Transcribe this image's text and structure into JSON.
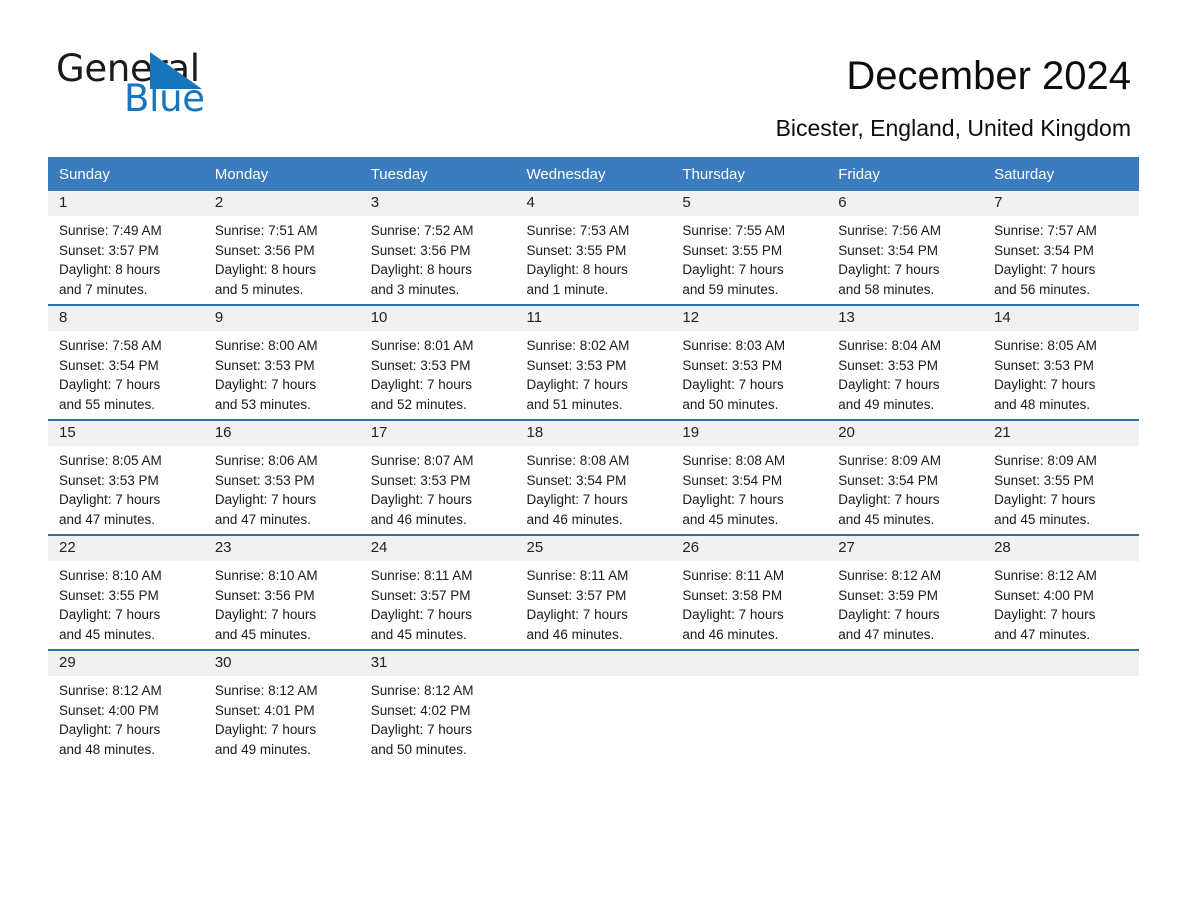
{
  "brand": {
    "name_part1": "General",
    "name_part2": "Blue",
    "accent_color": "#1675bc"
  },
  "header": {
    "title": "December 2024",
    "location": "Bicester, England, United Kingdom"
  },
  "calendar": {
    "header_bg": "#3a7cbe",
    "daynum_bg": "#f1f1f1",
    "weekdays": [
      "Sunday",
      "Monday",
      "Tuesday",
      "Wednesday",
      "Thursday",
      "Friday",
      "Saturday"
    ],
    "weeks": [
      [
        {
          "day": "1",
          "sunrise": "Sunrise: 7:49 AM",
          "sunset": "Sunset: 3:57 PM",
          "daylight1": "Daylight: 8 hours",
          "daylight2": "and 7 minutes."
        },
        {
          "day": "2",
          "sunrise": "Sunrise: 7:51 AM",
          "sunset": "Sunset: 3:56 PM",
          "daylight1": "Daylight: 8 hours",
          "daylight2": "and 5 minutes."
        },
        {
          "day": "3",
          "sunrise": "Sunrise: 7:52 AM",
          "sunset": "Sunset: 3:56 PM",
          "daylight1": "Daylight: 8 hours",
          "daylight2": "and 3 minutes."
        },
        {
          "day": "4",
          "sunrise": "Sunrise: 7:53 AM",
          "sunset": "Sunset: 3:55 PM",
          "daylight1": "Daylight: 8 hours",
          "daylight2": "and 1 minute."
        },
        {
          "day": "5",
          "sunrise": "Sunrise: 7:55 AM",
          "sunset": "Sunset: 3:55 PM",
          "daylight1": "Daylight: 7 hours",
          "daylight2": "and 59 minutes."
        },
        {
          "day": "6",
          "sunrise": "Sunrise: 7:56 AM",
          "sunset": "Sunset: 3:54 PM",
          "daylight1": "Daylight: 7 hours",
          "daylight2": "and 58 minutes."
        },
        {
          "day": "7",
          "sunrise": "Sunrise: 7:57 AM",
          "sunset": "Sunset: 3:54 PM",
          "daylight1": "Daylight: 7 hours",
          "daylight2": "and 56 minutes."
        }
      ],
      [
        {
          "day": "8",
          "sunrise": "Sunrise: 7:58 AM",
          "sunset": "Sunset: 3:54 PM",
          "daylight1": "Daylight: 7 hours",
          "daylight2": "and 55 minutes."
        },
        {
          "day": "9",
          "sunrise": "Sunrise: 8:00 AM",
          "sunset": "Sunset: 3:53 PM",
          "daylight1": "Daylight: 7 hours",
          "daylight2": "and 53 minutes."
        },
        {
          "day": "10",
          "sunrise": "Sunrise: 8:01 AM",
          "sunset": "Sunset: 3:53 PM",
          "daylight1": "Daylight: 7 hours",
          "daylight2": "and 52 minutes."
        },
        {
          "day": "11",
          "sunrise": "Sunrise: 8:02 AM",
          "sunset": "Sunset: 3:53 PM",
          "daylight1": "Daylight: 7 hours",
          "daylight2": "and 51 minutes."
        },
        {
          "day": "12",
          "sunrise": "Sunrise: 8:03 AM",
          "sunset": "Sunset: 3:53 PM",
          "daylight1": "Daylight: 7 hours",
          "daylight2": "and 50 minutes."
        },
        {
          "day": "13",
          "sunrise": "Sunrise: 8:04 AM",
          "sunset": "Sunset: 3:53 PM",
          "daylight1": "Daylight: 7 hours",
          "daylight2": "and 49 minutes."
        },
        {
          "day": "14",
          "sunrise": "Sunrise: 8:05 AM",
          "sunset": "Sunset: 3:53 PM",
          "daylight1": "Daylight: 7 hours",
          "daylight2": "and 48 minutes."
        }
      ],
      [
        {
          "day": "15",
          "sunrise": "Sunrise: 8:05 AM",
          "sunset": "Sunset: 3:53 PM",
          "daylight1": "Daylight: 7 hours",
          "daylight2": "and 47 minutes."
        },
        {
          "day": "16",
          "sunrise": "Sunrise: 8:06 AM",
          "sunset": "Sunset: 3:53 PM",
          "daylight1": "Daylight: 7 hours",
          "daylight2": "and 47 minutes."
        },
        {
          "day": "17",
          "sunrise": "Sunrise: 8:07 AM",
          "sunset": "Sunset: 3:53 PM",
          "daylight1": "Daylight: 7 hours",
          "daylight2": "and 46 minutes."
        },
        {
          "day": "18",
          "sunrise": "Sunrise: 8:08 AM",
          "sunset": "Sunset: 3:54 PM",
          "daylight1": "Daylight: 7 hours",
          "daylight2": "and 46 minutes."
        },
        {
          "day": "19",
          "sunrise": "Sunrise: 8:08 AM",
          "sunset": "Sunset: 3:54 PM",
          "daylight1": "Daylight: 7 hours",
          "daylight2": "and 45 minutes."
        },
        {
          "day": "20",
          "sunrise": "Sunrise: 8:09 AM",
          "sunset": "Sunset: 3:54 PM",
          "daylight1": "Daylight: 7 hours",
          "daylight2": "and 45 minutes."
        },
        {
          "day": "21",
          "sunrise": "Sunrise: 8:09 AM",
          "sunset": "Sunset: 3:55 PM",
          "daylight1": "Daylight: 7 hours",
          "daylight2": "and 45 minutes."
        }
      ],
      [
        {
          "day": "22",
          "sunrise": "Sunrise: 8:10 AM",
          "sunset": "Sunset: 3:55 PM",
          "daylight1": "Daylight: 7 hours",
          "daylight2": "and 45 minutes."
        },
        {
          "day": "23",
          "sunrise": "Sunrise: 8:10 AM",
          "sunset": "Sunset: 3:56 PM",
          "daylight1": "Daylight: 7 hours",
          "daylight2": "and 45 minutes."
        },
        {
          "day": "24",
          "sunrise": "Sunrise: 8:11 AM",
          "sunset": "Sunset: 3:57 PM",
          "daylight1": "Daylight: 7 hours",
          "daylight2": "and 45 minutes."
        },
        {
          "day": "25",
          "sunrise": "Sunrise: 8:11 AM",
          "sunset": "Sunset: 3:57 PM",
          "daylight1": "Daylight: 7 hours",
          "daylight2": "and 46 minutes."
        },
        {
          "day": "26",
          "sunrise": "Sunrise: 8:11 AM",
          "sunset": "Sunset: 3:58 PM",
          "daylight1": "Daylight: 7 hours",
          "daylight2": "and 46 minutes."
        },
        {
          "day": "27",
          "sunrise": "Sunrise: 8:12 AM",
          "sunset": "Sunset: 3:59 PM",
          "daylight1": "Daylight: 7 hours",
          "daylight2": "and 47 minutes."
        },
        {
          "day": "28",
          "sunrise": "Sunrise: 8:12 AM",
          "sunset": "Sunset: 4:00 PM",
          "daylight1": "Daylight: 7 hours",
          "daylight2": "and 47 minutes."
        }
      ],
      [
        {
          "day": "29",
          "sunrise": "Sunrise: 8:12 AM",
          "sunset": "Sunset: 4:00 PM",
          "daylight1": "Daylight: 7 hours",
          "daylight2": "and 48 minutes."
        },
        {
          "day": "30",
          "sunrise": "Sunrise: 8:12 AM",
          "sunset": "Sunset: 4:01 PM",
          "daylight1": "Daylight: 7 hours",
          "daylight2": "and 49 minutes."
        },
        {
          "day": "31",
          "sunrise": "Sunrise: 8:12 AM",
          "sunset": "Sunset: 4:02 PM",
          "daylight1": "Daylight: 7 hours",
          "daylight2": "and 50 minutes."
        },
        {
          "day": "",
          "sunrise": "",
          "sunset": "",
          "daylight1": "",
          "daylight2": "",
          "blank": true
        },
        {
          "day": "",
          "sunrise": "",
          "sunset": "",
          "daylight1": "",
          "daylight2": "",
          "blank": true
        },
        {
          "day": "",
          "sunrise": "",
          "sunset": "",
          "daylight1": "",
          "daylight2": "",
          "blank": true
        },
        {
          "day": "",
          "sunrise": "",
          "sunset": "",
          "daylight1": "",
          "daylight2": "",
          "blank": true
        }
      ]
    ]
  }
}
